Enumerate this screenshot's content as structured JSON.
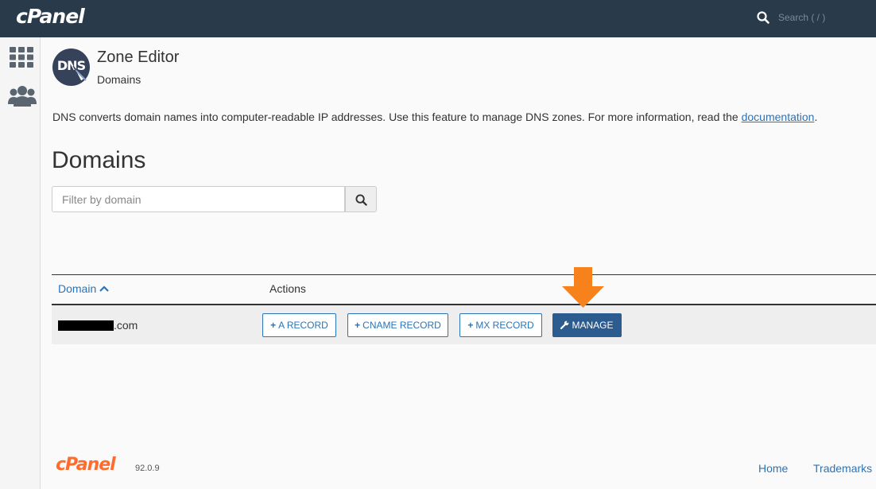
{
  "header": {
    "logo": "cPanel",
    "search_placeholder": "Search ( / )"
  },
  "sidebar": {
    "items": [
      {
        "icon": "grid-icon"
      },
      {
        "icon": "users-icon"
      }
    ]
  },
  "page": {
    "icon_text": "DNS",
    "title": "Zone Editor",
    "subtitle": "Domains",
    "description": "DNS converts domain names into computer-readable IP addresses. Use this feature to manage DNS zones. For more information, read the ",
    "description_link": "documentation",
    "description_end": "."
  },
  "domains": {
    "heading": "Domains",
    "filter_placeholder": "Filter by domain",
    "columns": {
      "domain": "Domain",
      "actions": "Actions"
    },
    "rows": [
      {
        "domain_suffix": ".com",
        "buttons": {
          "a_record": "A RECORD",
          "cname_record": "CNAME RECORD",
          "mx_record": "MX RECORD",
          "manage": "MANAGE"
        }
      }
    ]
  },
  "footer": {
    "logo": "cPanel",
    "version": "92.0.9",
    "links": {
      "home": "Home",
      "trademarks": "Trademarks"
    }
  },
  "colors": {
    "topbar": "#293a4a",
    "link": "#2a74b8",
    "manage_button": "#2c5c8f",
    "arrow": "#f7821b",
    "footer_logo": "#ff6c2c"
  }
}
